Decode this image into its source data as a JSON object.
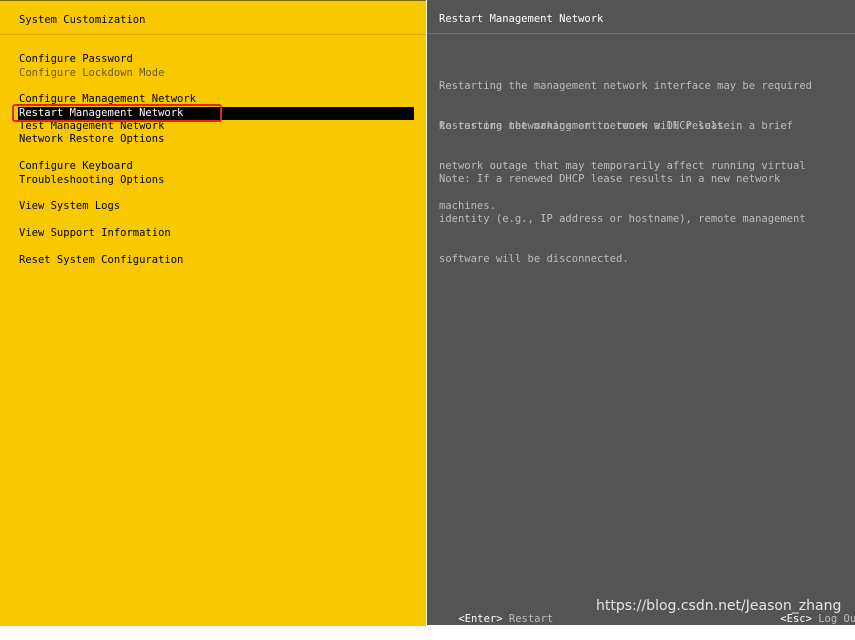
{
  "left_panel": {
    "title": "System Customization",
    "menu": [
      {
        "label": "Configure Password"
      },
      {
        "label": "Configure Lockdown Mode"
      },
      {
        "label": "Configure Management Network"
      },
      {
        "label": "Restart Management Network"
      },
      {
        "label": "Test Management Network"
      },
      {
        "label": "Network Restore Options"
      },
      {
        "label": "Configure Keyboard"
      },
      {
        "label": "Troubleshooting Options"
      },
      {
        "label": "View System Logs"
      },
      {
        "label": "View Support Information"
      },
      {
        "label": "Reset System Configuration"
      }
    ],
    "selected_item": "Restart Management Network"
  },
  "right_panel": {
    "title": "Restart Management Network",
    "paragraphs": [
      [
        "Restarting the management network interface may be required",
        "to restore networking or to renew a DHCP lease."
      ],
      [
        "Restarting the management network will result in a brief",
        "network outage that may temporarily affect running virtual",
        "machines."
      ],
      [
        "Note: If a renewed DHCP lease results in a new network",
        "identity (e.g., IP address or hostname), remote management",
        "software will be disconnected."
      ]
    ]
  },
  "footer": {
    "enter_key": "<Enter>",
    "enter_action": "Restart",
    "esc_key": "<Esc>",
    "esc_action": "Log Out"
  },
  "watermark": "https://blog.csdn.net/Jeason_zhang",
  "colors": {
    "left_background": "#f9c900",
    "right_background": "#545454",
    "selection_background": "#000000",
    "highlight_border": "#e0251e"
  }
}
